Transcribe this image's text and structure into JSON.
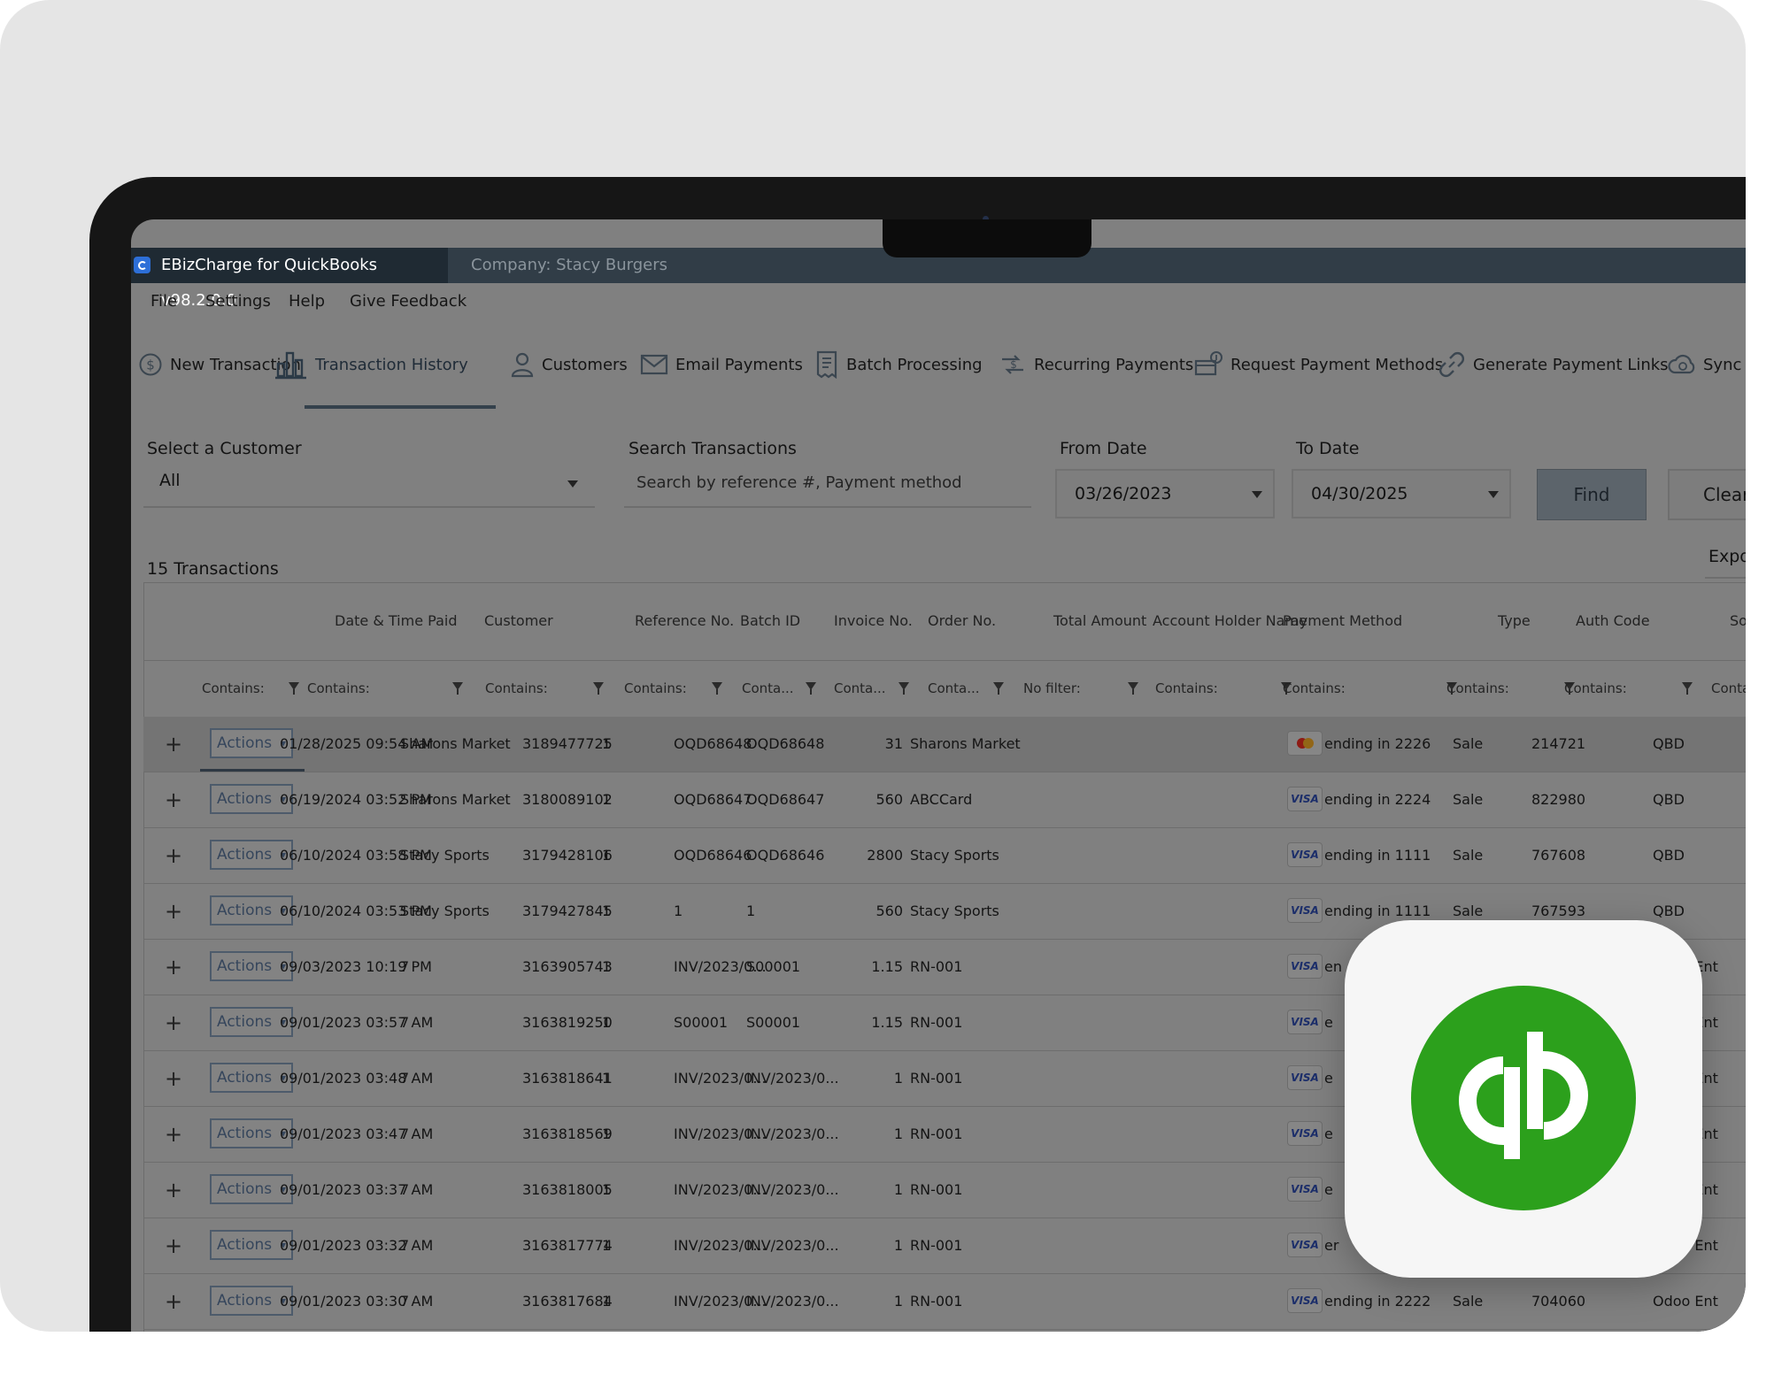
{
  "window": {
    "app_title": "EBizCharge for QuickBooks v98.2.0.0",
    "company": "Company: Stacy Burgers"
  },
  "menu": [
    "File",
    "Settings",
    "Help",
    "Give Feedback"
  ],
  "nav": [
    {
      "label": "New Transaction",
      "icon": "dollar-circle-icon"
    },
    {
      "label": "Transaction History",
      "icon": "bar-chart-icon",
      "active": true
    },
    {
      "label": "Customers",
      "icon": "user-icon"
    },
    {
      "label": "Email Payments",
      "icon": "envelope-icon"
    },
    {
      "label": "Batch Processing",
      "icon": "document-list-icon"
    },
    {
      "label": "Recurring Payments",
      "icon": "recurring-dollar-icon"
    },
    {
      "label": "Request Payment Methods",
      "icon": "request-card-icon"
    },
    {
      "label": "Generate Payment Links",
      "icon": "link-icon"
    },
    {
      "label": "Sync",
      "icon": "cloud-sync-icon"
    }
  ],
  "filters": {
    "customer_label": "Select a Customer",
    "customer_value": "All",
    "search_label": "Search Transactions",
    "search_placeholder": "Search by reference #, Payment method",
    "from_label": "From Date",
    "from_value": "03/26/2023",
    "to_label": "To Date",
    "to_value": "04/30/2025",
    "find_label": "Find",
    "clear_label": "Clear",
    "export_label": "Expo"
  },
  "count_text": "15 Transactions",
  "columns": [
    "Date & Time Paid",
    "Customer",
    "Reference No.",
    "Batch ID",
    "Invoice No.",
    "Order No.",
    "Total Amount",
    "Account Holder Name",
    "Payment Method",
    "Type",
    "Auth Code",
    "So"
  ],
  "filter_texts": [
    "Contains:",
    "Contains:",
    "Contains:",
    "Contains:",
    "Conta...",
    "Conta...",
    "Conta...",
    "No filter:",
    "Contains:",
    "Contains:",
    "Contains:",
    "Contains:",
    "Contains:"
  ],
  "actions_label": "Actions",
  "expand_symbol": "+",
  "rows": [
    {
      "date": "01/28/2025 09:54 AM",
      "customer": "Sharons Market",
      "ref": "3189477725",
      "batch": "1",
      "invoice": "OQD68648",
      "order": "OQD68648",
      "amount": "31",
      "holder": "Sharons Market",
      "card": "mastercard",
      "pm": "ending in 2226",
      "type": "Sale",
      "auth": "214721",
      "source": "QBD"
    },
    {
      "date": "06/19/2024 03:52 PM",
      "customer": "Sharons Market",
      "ref": "3180089102",
      "batch": "1",
      "invoice": "OQD68647",
      "order": "OQD68647",
      "amount": "560",
      "holder": "ABCCard",
      "card": "visa",
      "pm": "ending in 2224",
      "type": "Sale",
      "auth": "822980",
      "source": "QBD"
    },
    {
      "date": "06/10/2024 03:58 PM",
      "customer": "Stacy Sports",
      "ref": "3179428106",
      "batch": "1",
      "invoice": "OQD68646",
      "order": "OQD68646",
      "amount": "2800",
      "holder": "Stacy Sports",
      "card": "visa",
      "pm": "ending in 1111",
      "type": "Sale",
      "auth": "767608",
      "source": "QBD"
    },
    {
      "date": "06/10/2024 03:53 PM",
      "customer": "Stacy Sports",
      "ref": "3179427845",
      "batch": "1",
      "invoice": "1",
      "order": "1",
      "amount": "560",
      "holder": "Stacy Sports",
      "card": "visa",
      "pm": "ending in 1111",
      "type": "Sale",
      "auth": "767593",
      "source": "QBD"
    },
    {
      "date": "09/03/2023 10:19 PM",
      "customer": "7",
      "ref": "3163905743",
      "batch": "1",
      "invoice": "INV/2023/0...",
      "order": "S00001",
      "amount": "1.15",
      "holder": "RN-001",
      "card": "visa",
      "pm": "en",
      "type": "",
      "auth": "",
      "source": "Odoo Ent"
    },
    {
      "date": "09/01/2023 03:57 AM",
      "customer": "7",
      "ref": "3163819250",
      "batch": "1",
      "invoice": "S00001",
      "order": "S00001",
      "amount": "1.15",
      "holder": "RN-001",
      "card": "visa",
      "pm": "e",
      "type": "",
      "auth": "",
      "source": "Odoo Ent"
    },
    {
      "date": "09/01/2023 03:48 AM",
      "customer": "7",
      "ref": "3163818641",
      "batch": "1",
      "invoice": "INV/2023/0...",
      "order": "INV/2023/0...",
      "amount": "1",
      "holder": "RN-001",
      "card": "visa",
      "pm": "e",
      "type": "",
      "auth": "",
      "source": "Odoo Ent"
    },
    {
      "date": "09/01/2023 03:47 AM",
      "customer": "7",
      "ref": "3163818569",
      "batch": "1",
      "invoice": "INV/2023/0...",
      "order": "INV/2023/0...",
      "amount": "1",
      "holder": "RN-001",
      "card": "visa",
      "pm": "e",
      "type": "",
      "auth": "",
      "source": "Odoo Ent"
    },
    {
      "date": "09/01/2023 03:37 AM",
      "customer": "7",
      "ref": "3163818005",
      "batch": "1",
      "invoice": "INV/2023/0...",
      "order": "INV/2023/0...",
      "amount": "1",
      "holder": "RN-001",
      "card": "visa",
      "pm": "e",
      "type": "",
      "auth": "",
      "source": "Odoo Ent"
    },
    {
      "date": "09/01/2023 03:32 AM",
      "customer": "7",
      "ref": "3163817774",
      "batch": "1",
      "invoice": "INV/2023/0...",
      "order": "INV/2023/0...",
      "amount": "1",
      "holder": "RN-001",
      "card": "visa",
      "pm": "er",
      "type": "",
      "auth": "",
      "source": "Odoo Ent"
    },
    {
      "date": "09/01/2023 03:30 AM",
      "customer": "7",
      "ref": "3163817684",
      "batch": "1",
      "invoice": "INV/2023/0...",
      "order": "INV/2023/0...",
      "amount": "1",
      "holder": "RN-001",
      "card": "visa",
      "pm": "ending in 2222",
      "type": "Sale",
      "auth": "704060",
      "source": "Odoo Ent"
    }
  ],
  "visa_text": "VISA",
  "colors": {
    "quickbooks_green": "#2ca01c",
    "overlay_gray": "#808080",
    "titlebar": "#313d47"
  }
}
